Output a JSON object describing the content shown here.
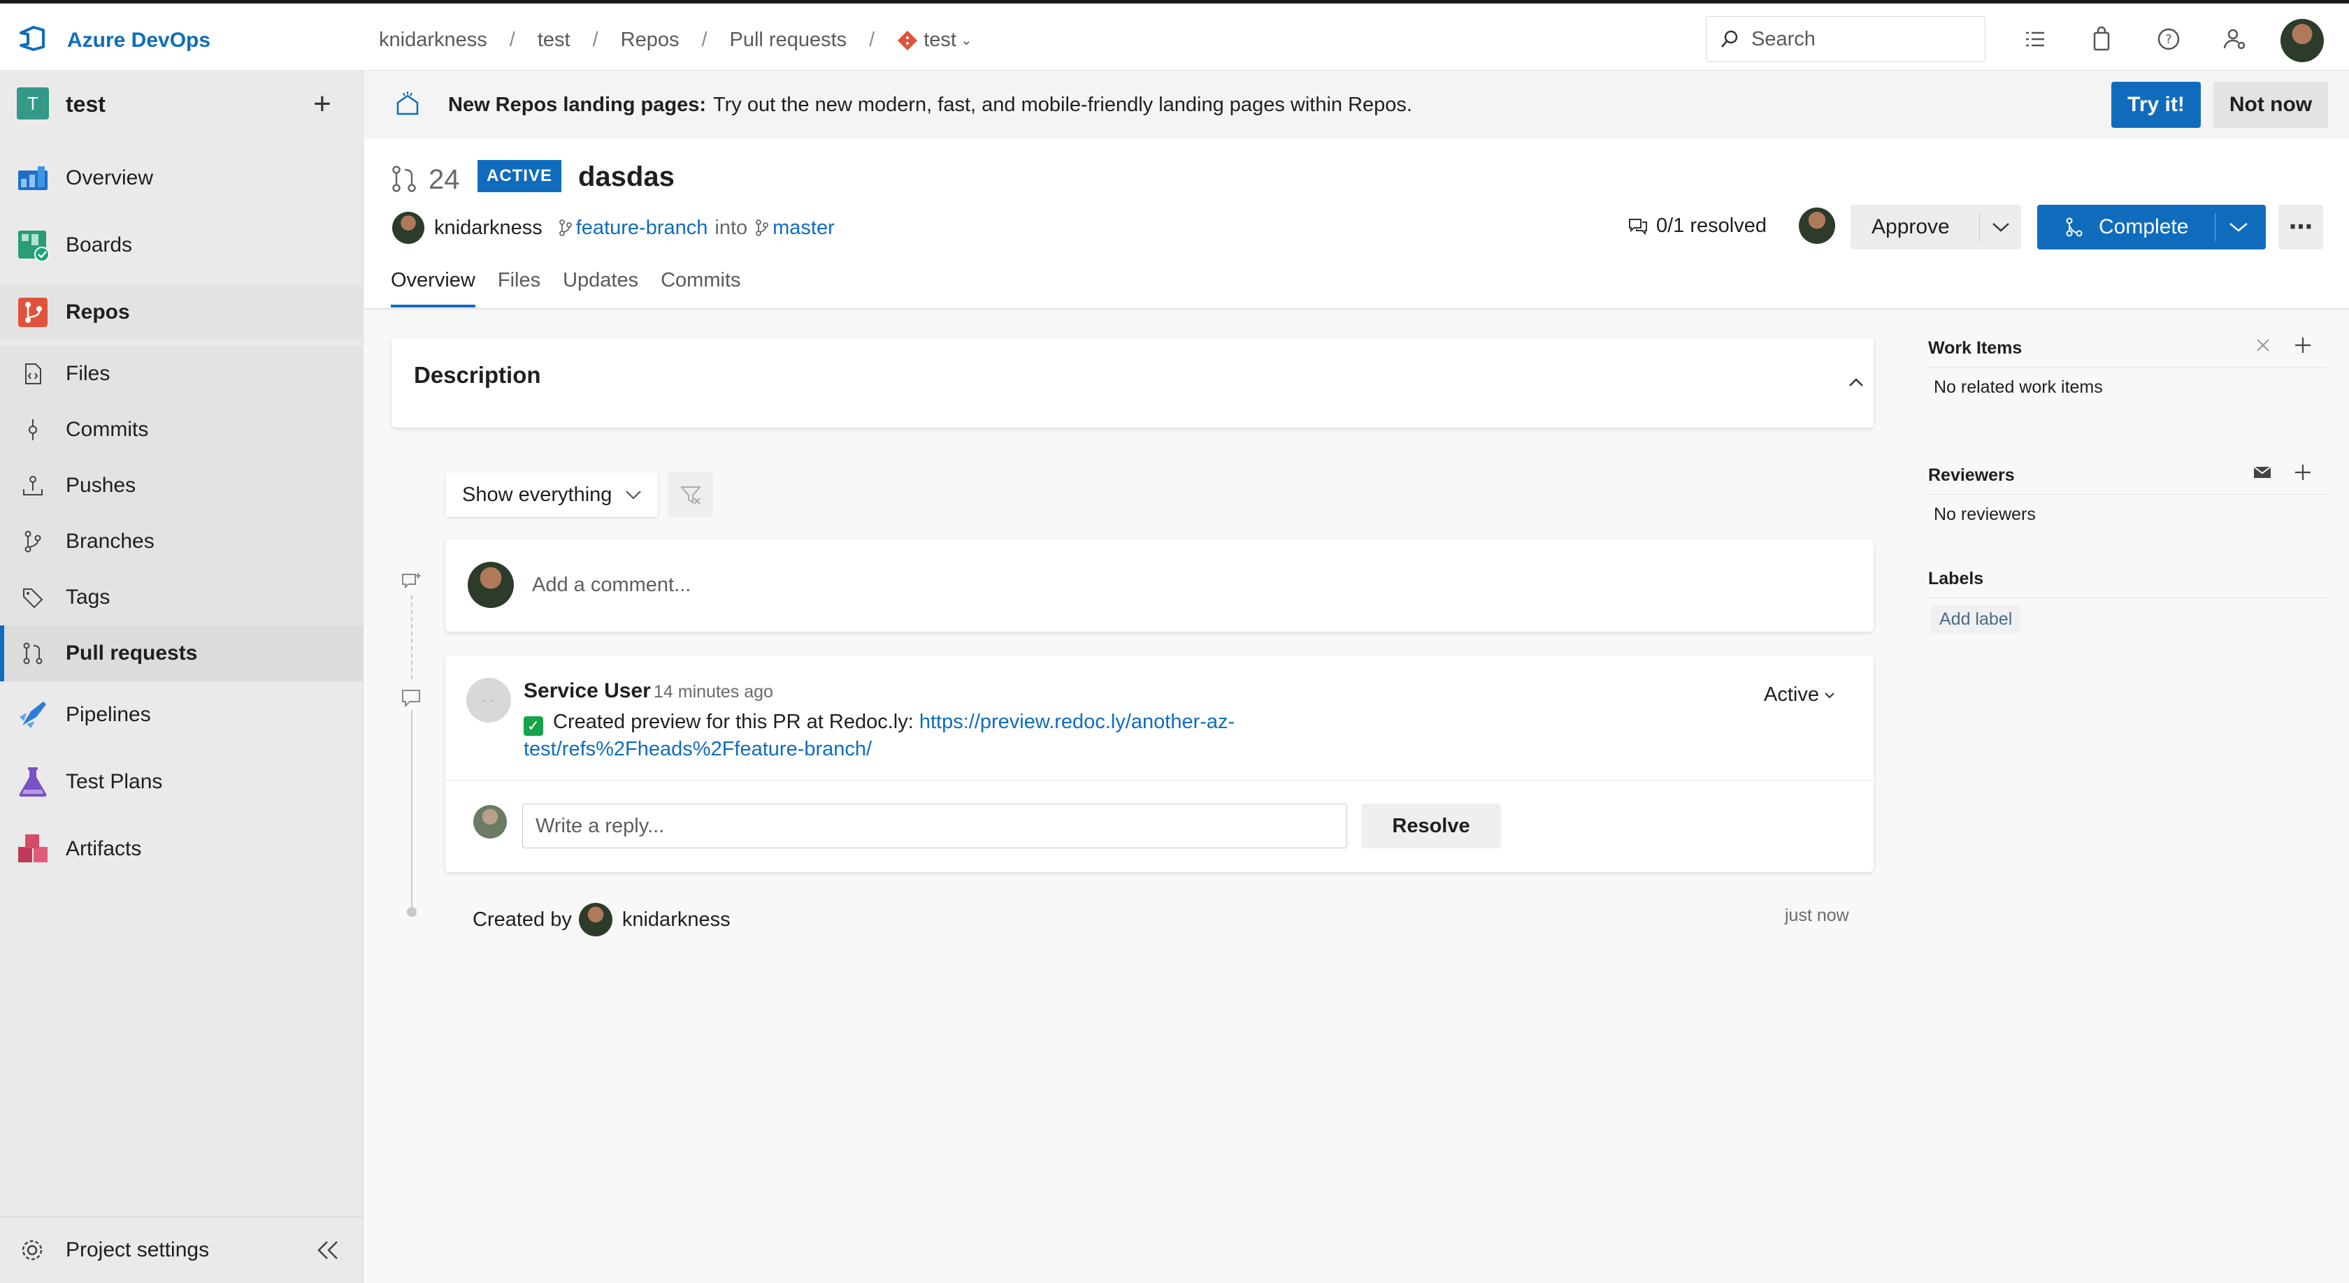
{
  "topbar": {
    "brand": "Azure DevOps",
    "breadcrumbs": [
      "knidarkness",
      "test",
      "Repos",
      "Pull requests",
      "test"
    ],
    "search_placeholder": "Search"
  },
  "sidebar": {
    "project_initial": "T",
    "project_name": "test",
    "items": [
      {
        "label": "Overview"
      },
      {
        "label": "Boards"
      },
      {
        "label": "Repos"
      },
      {
        "label": "Files"
      },
      {
        "label": "Commits"
      },
      {
        "label": "Pushes"
      },
      {
        "label": "Branches"
      },
      {
        "label": "Tags"
      },
      {
        "label": "Pull requests"
      },
      {
        "label": "Pipelines"
      },
      {
        "label": "Test Plans"
      },
      {
        "label": "Artifacts"
      }
    ],
    "settings_label": "Project settings"
  },
  "banner": {
    "title": "New Repos landing pages:",
    "text": "Try out the new modern, fast, and mobile-friendly landing pages within Repos.",
    "try_label": "Try it!",
    "not_now_label": "Not now"
  },
  "pr": {
    "number": "24",
    "status": "ACTIVE",
    "title": "dasdas",
    "author": "knidarkness",
    "source_branch": "feature-branch",
    "into": "into",
    "target_branch": "master",
    "resolved": "0/1 resolved",
    "approve_label": "Approve",
    "complete_label": "Complete",
    "tabs": [
      "Overview",
      "Files",
      "Updates",
      "Commits"
    ]
  },
  "description": {
    "title": "Description"
  },
  "filter": {
    "selected": "Show everything"
  },
  "comment_box": {
    "placeholder": "Add a comment..."
  },
  "thread": {
    "author": "Service User",
    "time": "14 minutes ago",
    "status": "Active",
    "text": "Created preview for this PR at Redoc.ly:",
    "link": "https://preview.redoc.ly/another-az-test/refs%2Fheads%2Ffeature-branch/",
    "reply_placeholder": "Write a reply...",
    "resolve_label": "Resolve"
  },
  "created": {
    "prefix": "Created by",
    "author": "knidarkness",
    "time": "just now"
  },
  "right_panel": {
    "work_items_title": "Work Items",
    "work_items_empty": "No related work items",
    "reviewers_title": "Reviewers",
    "reviewers_empty": "No reviewers",
    "labels_title": "Labels",
    "add_label": "Add label"
  },
  "colors": {
    "accent": "#0f6cbd",
    "project_badge": "#339989",
    "success_check": "#16a34a"
  }
}
